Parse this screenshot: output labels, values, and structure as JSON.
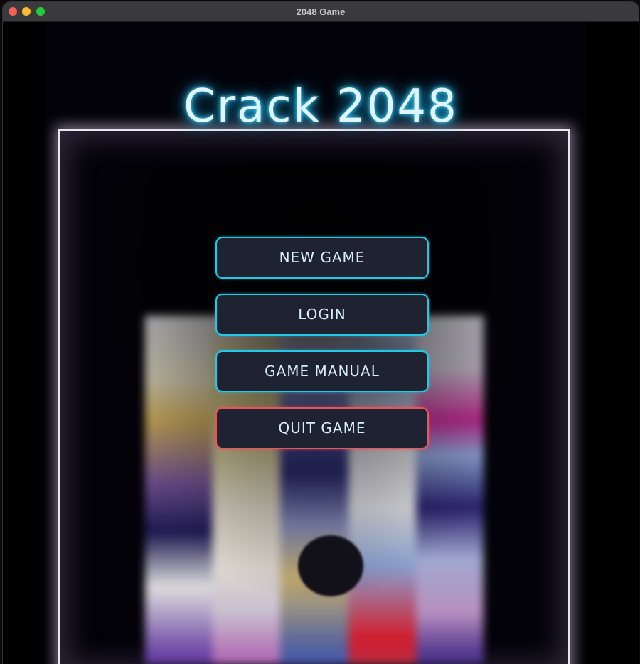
{
  "window": {
    "title": "2048 Game"
  },
  "app": {
    "title": "Crack 2048"
  },
  "menu": {
    "buttons": [
      {
        "label": "NEW GAME",
        "border_color": "#22c8e6"
      },
      {
        "label": "LOGIN",
        "border_color": "#22c8e6"
      },
      {
        "label": "GAME MANUAL",
        "border_color": "#22c8e6"
      },
      {
        "label": "QUIT GAME",
        "border_color": "#e8555c"
      }
    ]
  },
  "colors": {
    "accent": "#22c8e6",
    "danger": "#e8555c",
    "button_bg": "#1f2230",
    "title_glow": "#44d8ff"
  }
}
